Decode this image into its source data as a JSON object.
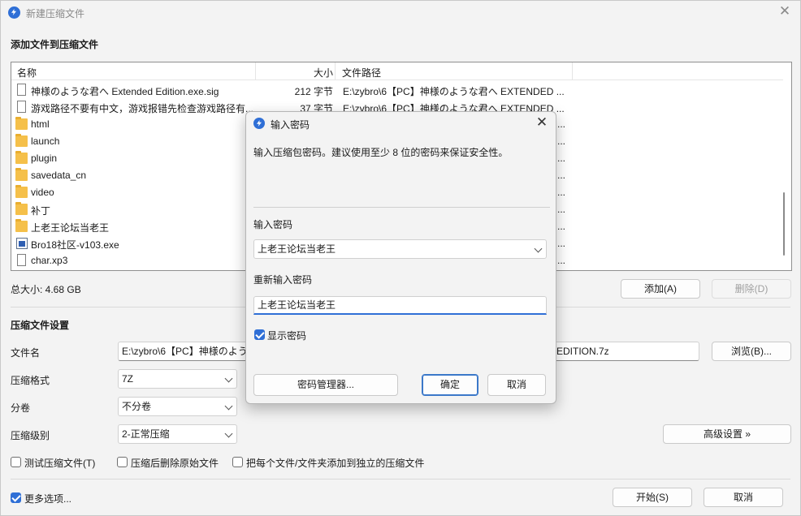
{
  "window": {
    "title": "新建压缩文件",
    "close_glyph": "✕"
  },
  "add_section": {
    "title": "添加文件到压缩文件",
    "columns": {
      "name": "名称",
      "size": "大小",
      "path": "文件路径"
    },
    "rows": [
      {
        "icon": "doc",
        "name": "神様のような君へ Extended Edition.exe.sig",
        "size": "212 字节",
        "path": "E:\\zybro\\6【PC】神様のような君へ EXTENDED ..."
      },
      {
        "icon": "doc",
        "name": "游戏路径不要有中文，游戏报错先检查游戏路径有...",
        "size": "37 字节",
        "path": "E:\\zybro\\6【PC】神様のような君へ EXTENDED ..."
      },
      {
        "icon": "folder",
        "name": "html",
        "size": "",
        "path": "..."
      },
      {
        "icon": "folder",
        "name": "launch",
        "size": "",
        "path": "..."
      },
      {
        "icon": "folder",
        "name": "plugin",
        "size": "",
        "path": "..."
      },
      {
        "icon": "folder",
        "name": "savedata_cn",
        "size": "",
        "path": "..."
      },
      {
        "icon": "folder",
        "name": "video",
        "size": "",
        "path": "..."
      },
      {
        "icon": "folder",
        "name": "补丁",
        "size": "",
        "path": "..."
      },
      {
        "icon": "folder",
        "name": "上老王论坛当老王",
        "size": "",
        "path": "..."
      },
      {
        "icon": "exe",
        "name": "Bro18社区-v103.exe",
        "size": "",
        "path": "..."
      },
      {
        "icon": "doc",
        "name": "char.xp3",
        "size": "",
        "path": "..."
      }
    ],
    "total_size": "总大小: 4.68 GB",
    "add_button": "添加(A)",
    "delete_button": "删除(D)"
  },
  "settings": {
    "title": "压缩文件设置",
    "filename_label": "文件名",
    "filename_value": "E:\\zybro\\6【PC】神様のよう",
    "filename_value_tail": "EDITION.7z",
    "browse_button": "浏览(B)...",
    "format_label": "压缩格式",
    "format_value": "7Z",
    "volume_label": "分卷",
    "volume_value": "不分卷",
    "level_label": "压缩级别",
    "level_value": "2-正常压缩",
    "advanced_button": "高级设置 »",
    "test_label": "测试压缩文件(T)",
    "delete_after_label": "压缩后删除原始文件",
    "separate_label": "把每个文件/文件夹添加到独立的压缩文件",
    "more_options_label": "更多选项...",
    "start_button": "开始(S)",
    "cancel_button": "取消"
  },
  "dialog": {
    "title": "输入密码",
    "close_glyph": "✕",
    "description": "输入压缩包密码。建议使用至少 8 位的密码来保证安全性。",
    "password_label": "输入密码",
    "password_value": "上老王论坛当老王",
    "reenter_label": "重新输入密码",
    "reenter_value": "上老王论坛当老王",
    "show_password_label": "显示密码",
    "manager_button": "密码管理器...",
    "ok_button": "确定",
    "cancel_button": "取消"
  },
  "colors": {
    "accent": "#2f6fd6",
    "folder": "#f5c04a"
  }
}
